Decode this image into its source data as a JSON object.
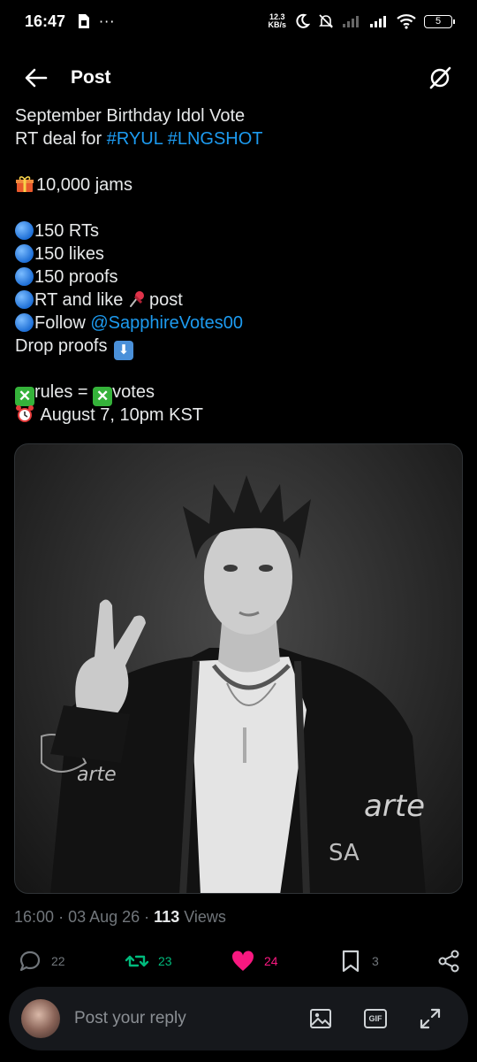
{
  "status_bar": {
    "time": "16:47",
    "net_speed_value": "12.3",
    "net_speed_unit": "KB/s",
    "battery": "5"
  },
  "header": {
    "title": "Post"
  },
  "tweet": {
    "lines": [
      {
        "text": "September Birthday Idol Vote"
      },
      {
        "prefix": "RT deal for ",
        "hashtags": [
          "#RYUL",
          "#LNGSHOT"
        ]
      },
      {
        "emoji": "gift",
        "text": "10,000 jams"
      },
      {
        "bullet": "blue-circle",
        "text": "150 RTs"
      },
      {
        "bullet": "blue-circle",
        "text": "150 likes"
      },
      {
        "bullet": "blue-circle",
        "text": "150 proofs"
      },
      {
        "bullet": "blue-circle",
        "text": "RT and like",
        "emoji": "pushpin",
        "suffix": "post"
      },
      {
        "bullet": "blue-circle",
        "text": "Follow",
        "mention": "@SapphireVotes00"
      },
      {
        "text": "Drop proofs",
        "emoji": "down-arrow"
      },
      {
        "text": "rules =",
        "suffix": "votes"
      },
      {
        "emoji": "alarm-clock",
        "text": "August 7, 10pm KST"
      }
    ]
  },
  "meta": {
    "time": "16:00",
    "date": "03 Aug 26",
    "views_count": "113",
    "views_label": "Views"
  },
  "actions": {
    "replies": "22",
    "reposts": "23",
    "likes": "24",
    "bookmarks": "3"
  },
  "reply_bar": {
    "placeholder": "Post your reply",
    "gif_label": "GIF"
  },
  "colors": {
    "link": "#1d9bf0",
    "repost": "#00ba7c",
    "like": "#f91880",
    "muted": "#71767b"
  }
}
